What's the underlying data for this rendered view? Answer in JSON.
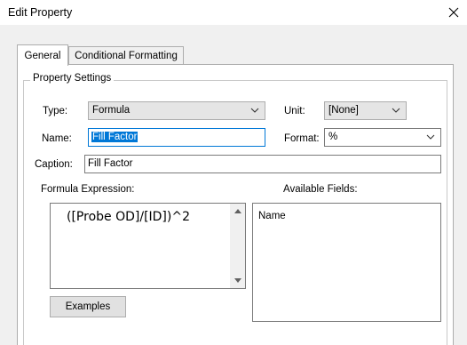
{
  "window": {
    "title": "Edit Property"
  },
  "tabs": [
    {
      "label": "General",
      "active": true
    },
    {
      "label": "Conditional Formatting",
      "active": false
    }
  ],
  "group": {
    "label": "Property Settings"
  },
  "type_field": {
    "label": "Type:",
    "value": "Formula"
  },
  "unit_field": {
    "label": "Unit:",
    "value": "[None]"
  },
  "name_field": {
    "label": "Name:",
    "value": "Fill Factor"
  },
  "format_field": {
    "label": "Format:",
    "value": "%"
  },
  "caption_field": {
    "label": "Caption:",
    "value": "Fill Factor"
  },
  "formula": {
    "label": "Formula Expression:",
    "value": "([Probe OD]/[ID])^2"
  },
  "fields": {
    "label": "Available Fields:",
    "column_header": "Name"
  },
  "examples_button": {
    "label": "Examples"
  },
  "icons": [
    "close-icon",
    "chevron-down-icon",
    "scroll-up-icon",
    "scroll-down-icon"
  ]
}
